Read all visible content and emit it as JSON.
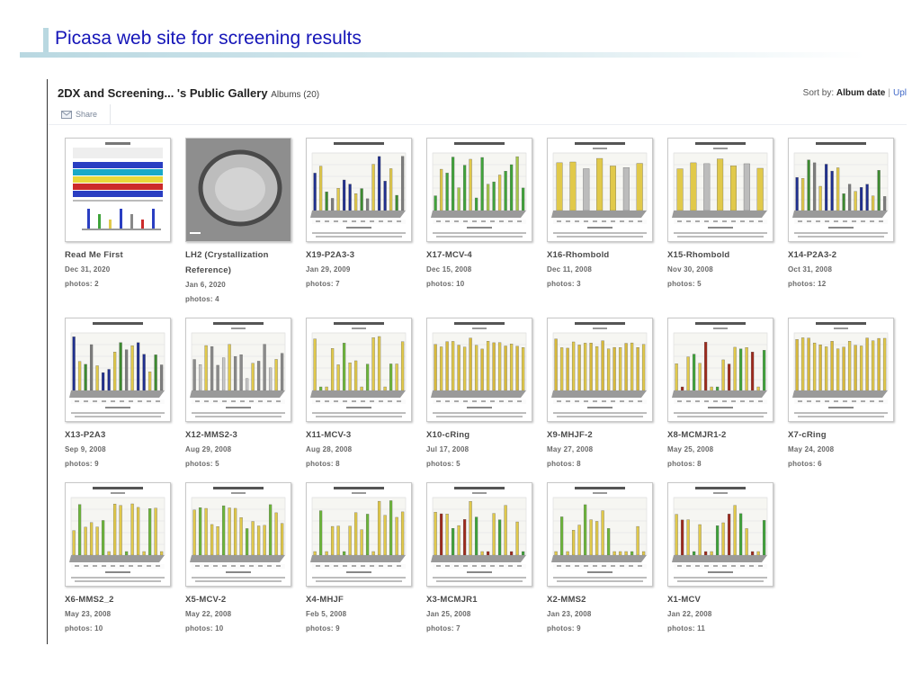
{
  "slide": {
    "title": "Picasa web site for screening results"
  },
  "gallery": {
    "owner_title": "2DX and Screening... 's Public Gallery",
    "albums_label": "Albums (20)",
    "sort_prefix": "Sort by:",
    "sort_value": "Album date",
    "sort_separator": "|",
    "sort_link": "Upl",
    "share_label": "Share"
  },
  "colors": {
    "slide_title": "#1515b8",
    "accent_bar": "#b9d8e1",
    "album_title": "#4a4a4a",
    "link": "#4169c8"
  },
  "albums": [
    {
      "title": "Read Me First",
      "date": "Dec 31, 2020",
      "photos": "photos: 2",
      "thumb": "doc"
    },
    {
      "title": "LH2 (Crystallization Reference)",
      "date": "Jan 6, 2020",
      "photos": "photos: 4",
      "thumb": "photo"
    },
    {
      "title": "X19-P2A3-3",
      "date": "Jan 29, 2009",
      "photos": "photos: 7",
      "thumb": "bars-mixed"
    },
    {
      "title": "X17-MCV-4",
      "date": "Dec 15, 2008",
      "photos": "photos: 10",
      "thumb": "bars-green"
    },
    {
      "title": "X16-Rhombold",
      "date": "Dec 11, 2008",
      "photos": "photos: 3",
      "thumb": "bars-sparse"
    },
    {
      "title": "X15-Rhombold",
      "date": "Nov 30, 2008",
      "photos": "photos: 5",
      "thumb": "bars-sparse"
    },
    {
      "title": "X14-P2A3-2",
      "date": "Oct 31, 2008",
      "photos": "photos: 12",
      "thumb": "bars-mixed"
    },
    {
      "title": "X13-P2A3",
      "date": "Sep 9, 2008",
      "photos": "photos: 9",
      "thumb": "bars-mixed"
    },
    {
      "title": "X12-MMS2-3",
      "date": "Aug 29, 2008",
      "photos": "photos: 5",
      "thumb": "bars-gray"
    },
    {
      "title": "X11-MCV-3",
      "date": "Aug 28, 2008",
      "photos": "photos: 8",
      "thumb": "bars-yellow-green"
    },
    {
      "title": "X10-cRing",
      "date": "Jul 17, 2008",
      "photos": "photos: 5",
      "thumb": "bars-yellow"
    },
    {
      "title": "X9-MHJF-2",
      "date": "May 27, 2008",
      "photos": "photos: 8",
      "thumb": "bars-yellow"
    },
    {
      "title": "X8-MCMJR1-2",
      "date": "May 25, 2008",
      "photos": "photos: 8",
      "thumb": "bars-red"
    },
    {
      "title": "X7-cRing",
      "date": "May 24, 2008",
      "photos": "photos: 6",
      "thumb": "bars-yellow"
    },
    {
      "title": "X6-MMS2_2",
      "date": "May 23, 2008",
      "photos": "photos: 10",
      "thumb": "bars-yellow-green"
    },
    {
      "title": "X5-MCV-2",
      "date": "May 22, 2008",
      "photos": "photos: 10",
      "thumb": "bars-yellow-green"
    },
    {
      "title": "X4-MHJF",
      "date": "Feb 5, 2008",
      "photos": "photos: 9",
      "thumb": "bars-yellow-green"
    },
    {
      "title": "X3-MCMJR1",
      "date": "Jan 25, 2008",
      "photos": "photos: 7",
      "thumb": "bars-red"
    },
    {
      "title": "X2-MMS2",
      "date": "Jan 23, 2008",
      "photos": "photos: 9",
      "thumb": "bars-yellow-green"
    },
    {
      "title": "X1-MCV",
      "date": "Jan 22, 2008",
      "photos": "photos: 11",
      "thumb": "bars-red"
    }
  ]
}
